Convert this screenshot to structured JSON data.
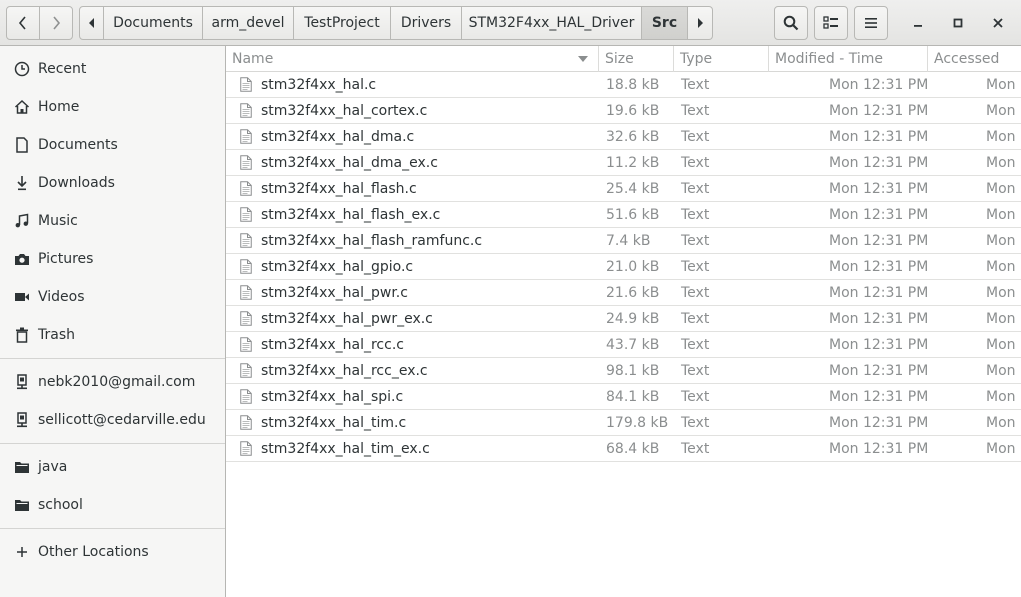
{
  "pathbar": {
    "crumbs": [
      "Documents",
      "arm_devel",
      "TestProject",
      "Drivers",
      "STM32F4xx_HAL_Driver",
      "Src"
    ]
  },
  "sidebar": {
    "places": [
      {
        "label": "Recent",
        "icon": "clock-icon"
      },
      {
        "label": "Home",
        "icon": "home-icon"
      },
      {
        "label": "Documents",
        "icon": "document-icon"
      },
      {
        "label": "Downloads",
        "icon": "download-icon"
      },
      {
        "label": "Music",
        "icon": "music-icon"
      },
      {
        "label": "Pictures",
        "icon": "camera-icon"
      },
      {
        "label": "Videos",
        "icon": "video-icon"
      },
      {
        "label": "Trash",
        "icon": "trash-icon"
      }
    ],
    "accounts": [
      {
        "label": "nebk2010@gmail.com",
        "icon": "network-account-icon"
      },
      {
        "label": "sellicott@cedarville.edu",
        "icon": "network-account-icon"
      }
    ],
    "bookmarks": [
      {
        "label": "java",
        "icon": "folder-icon"
      },
      {
        "label": "school",
        "icon": "folder-icon"
      }
    ],
    "other": {
      "label": "Other Locations",
      "icon": "plus-icon"
    }
  },
  "columns": {
    "name": "Name",
    "size": "Size",
    "type": "Type",
    "modified": "Modified - Time",
    "accessed": "Accessed"
  },
  "files": [
    {
      "name": "stm32f4xx_hal.c",
      "size": "18.8 kB",
      "type": "Text",
      "modified": "Mon 12:31 PM",
      "accessed": "Mon"
    },
    {
      "name": "stm32f4xx_hal_cortex.c",
      "size": "19.6 kB",
      "type": "Text",
      "modified": "Mon 12:31 PM",
      "accessed": "Mon"
    },
    {
      "name": "stm32f4xx_hal_dma.c",
      "size": "32.6 kB",
      "type": "Text",
      "modified": "Mon 12:31 PM",
      "accessed": "Mon"
    },
    {
      "name": "stm32f4xx_hal_dma_ex.c",
      "size": "11.2 kB",
      "type": "Text",
      "modified": "Mon 12:31 PM",
      "accessed": "Mon"
    },
    {
      "name": "stm32f4xx_hal_flash.c",
      "size": "25.4 kB",
      "type": "Text",
      "modified": "Mon 12:31 PM",
      "accessed": "Mon"
    },
    {
      "name": "stm32f4xx_hal_flash_ex.c",
      "size": "51.6 kB",
      "type": "Text",
      "modified": "Mon 12:31 PM",
      "accessed": "Mon"
    },
    {
      "name": "stm32f4xx_hal_flash_ramfunc.c",
      "size": "7.4 kB",
      "type": "Text",
      "modified": "Mon 12:31 PM",
      "accessed": "Mon"
    },
    {
      "name": "stm32f4xx_hal_gpio.c",
      "size": "21.0 kB",
      "type": "Text",
      "modified": "Mon 12:31 PM",
      "accessed": "Mon"
    },
    {
      "name": "stm32f4xx_hal_pwr.c",
      "size": "21.6 kB",
      "type": "Text",
      "modified": "Mon 12:31 PM",
      "accessed": "Mon"
    },
    {
      "name": "stm32f4xx_hal_pwr_ex.c",
      "size": "24.9 kB",
      "type": "Text",
      "modified": "Mon 12:31 PM",
      "accessed": "Mon"
    },
    {
      "name": "stm32f4xx_hal_rcc.c",
      "size": "43.7 kB",
      "type": "Text",
      "modified": "Mon 12:31 PM",
      "accessed": "Mon"
    },
    {
      "name": "stm32f4xx_hal_rcc_ex.c",
      "size": "98.1 kB",
      "type": "Text",
      "modified": "Mon 12:31 PM",
      "accessed": "Mon"
    },
    {
      "name": "stm32f4xx_hal_spi.c",
      "size": "84.1 kB",
      "type": "Text",
      "modified": "Mon 12:31 PM",
      "accessed": "Mon"
    },
    {
      "name": "stm32f4xx_hal_tim.c",
      "size": "179.8 kB",
      "type": "Text",
      "modified": "Mon 12:31 PM",
      "accessed": "Mon"
    },
    {
      "name": "stm32f4xx_hal_tim_ex.c",
      "size": "68.4 kB",
      "type": "Text",
      "modified": "Mon 12:31 PM",
      "accessed": "Mon"
    }
  ]
}
